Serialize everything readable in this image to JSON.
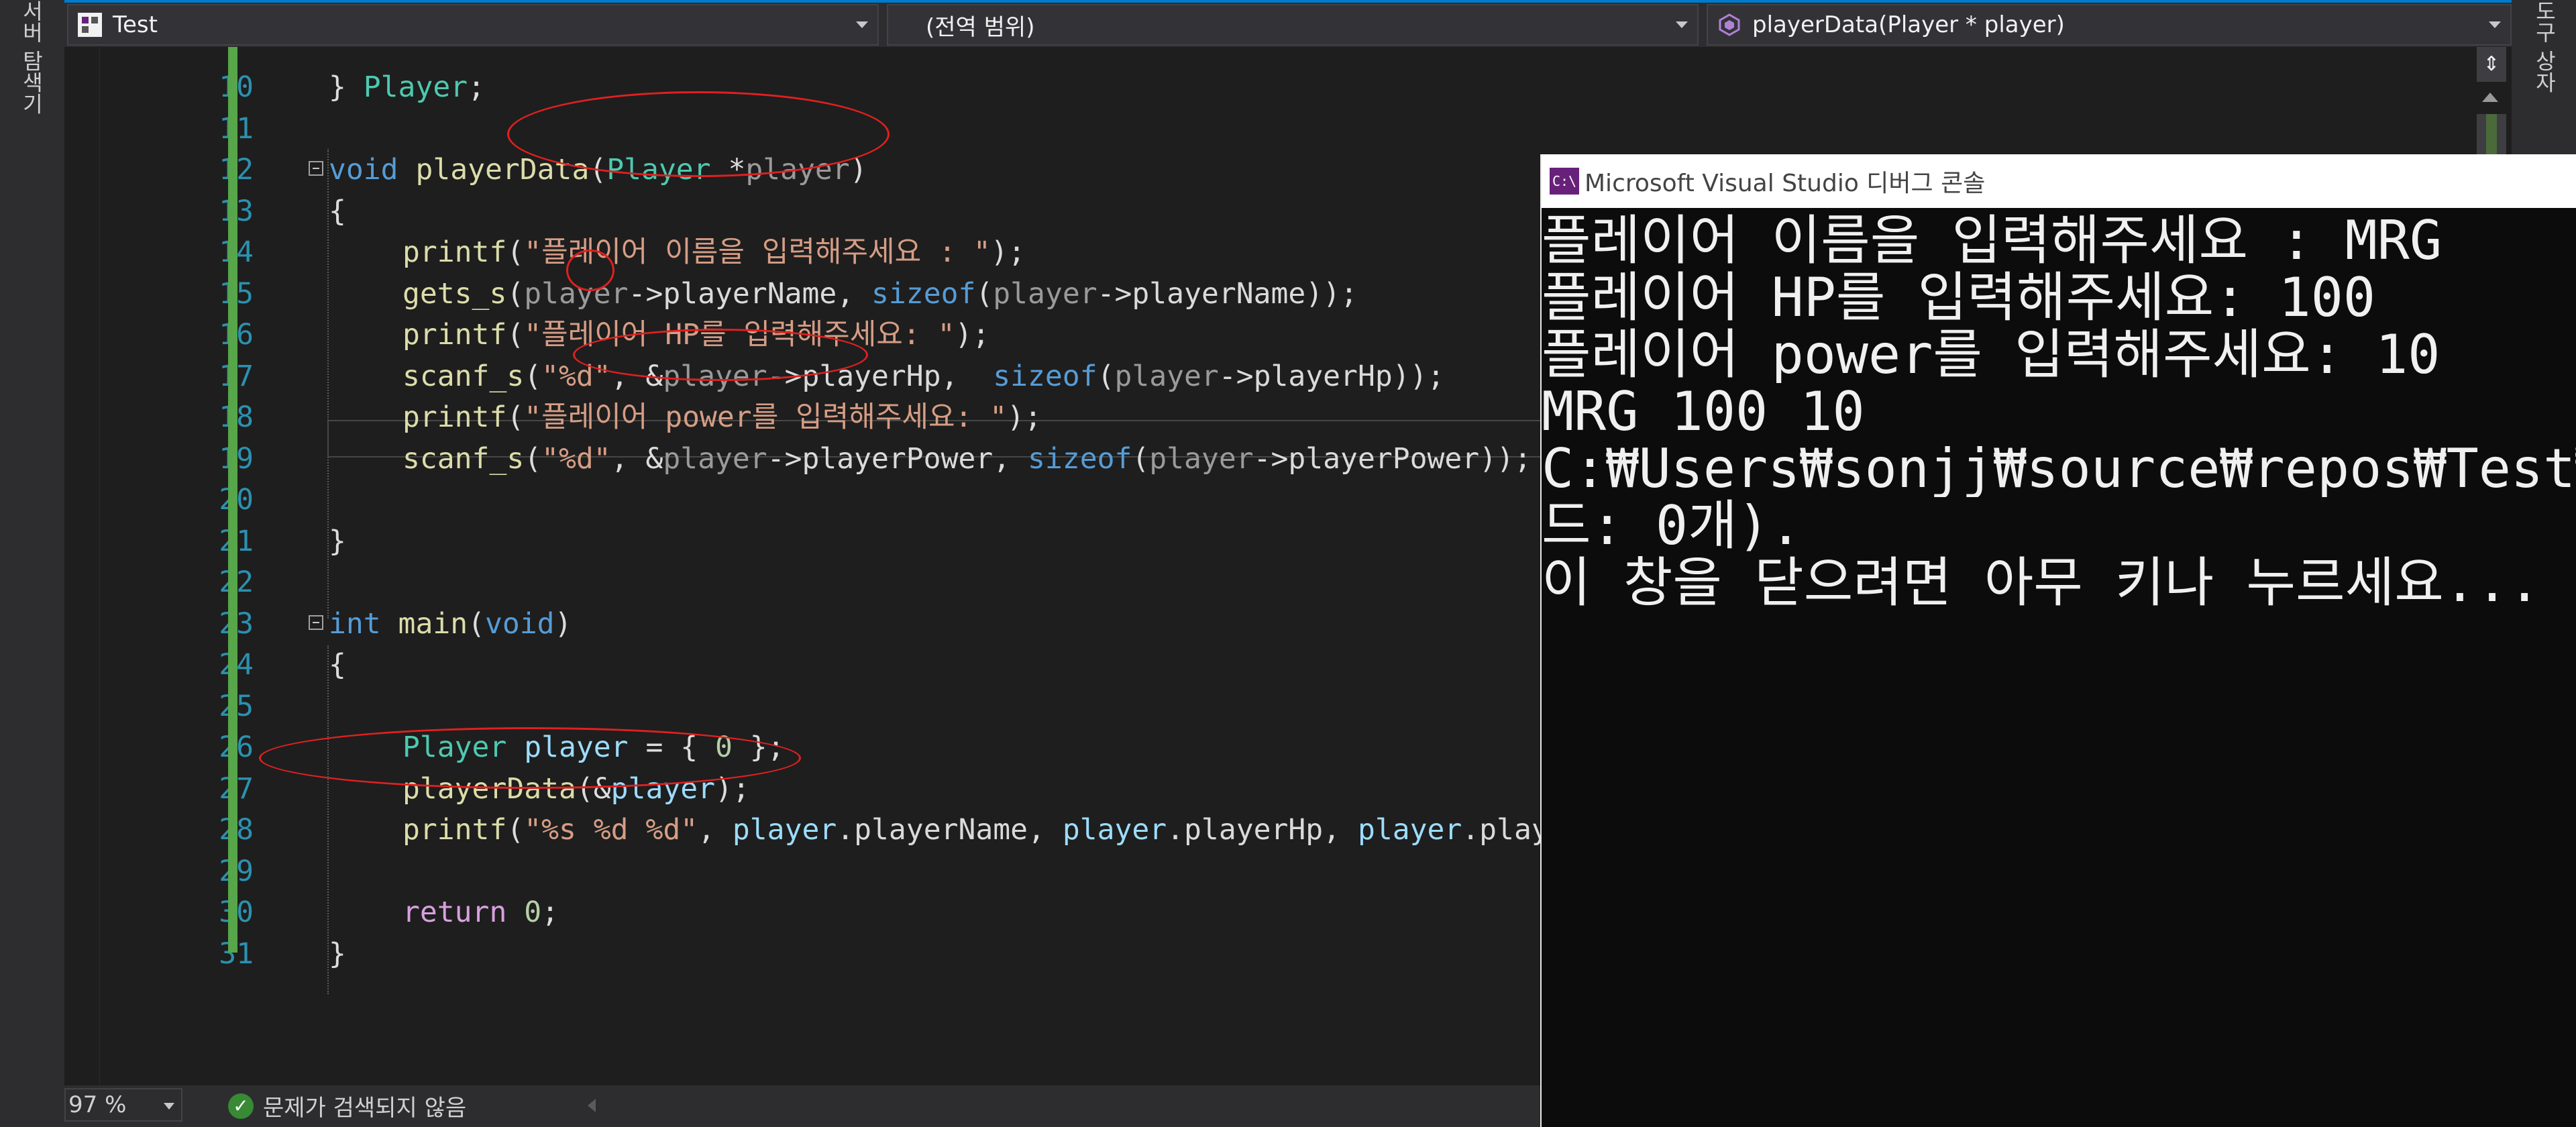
{
  "sidebars": {
    "left_label": "서버 탐색기",
    "right_label": "도구 상자"
  },
  "navbar": {
    "project": "Test",
    "scope": "(전역 범위)",
    "member": "playerData(Player * player)"
  },
  "editor": {
    "line_numbers": [
      "10",
      "11",
      "12",
      "13",
      "14",
      "15",
      "16",
      "17",
      "18",
      "19",
      "20",
      "21",
      "22",
      "23",
      "24",
      "25",
      "26",
      "27",
      "28",
      "29",
      "30",
      "31"
    ],
    "code": {
      "l10_close": "} ",
      "l10_type": "Player",
      "l10_semi": ";",
      "l12_void": "void",
      "l12_fn": "playerData",
      "l12_open": "(",
      "l12_type": "Player",
      "l12_star": " *",
      "l12_param": "player",
      "l12_close": ")",
      "l13": "{",
      "l14_fn": "printf",
      "l14_open": "(",
      "l14_str": "\"플레이어 이름을 입력해주세요 : \"",
      "l14_close": ");",
      "l15_fn": "gets_s",
      "l15_open": "(",
      "l15_p1": "player",
      "l15_arrow": "->",
      "l15_m1": "playerName",
      "l15_comma": ", ",
      "l15_sizeof": "sizeof",
      "l15_open2": "(",
      "l15_p2": "player",
      "l15_arrow2": "->",
      "l15_m2": "playerName",
      "l15_close": "));",
      "l16_fn": "printf",
      "l16_open": "(",
      "l16_str": "\"플레이어 HP를 입력해주세요: \"",
      "l16_close": ");",
      "l17_fn": "scanf_s",
      "l17_open": "(",
      "l17_str": "\"%d\"",
      "l17_comma": ", &",
      "l17_p1": "player",
      "l17_arrow": "->",
      "l17_m1": "playerHp",
      "l17_comma2": ",  ",
      "l17_sizeof": "sizeof",
      "l17_open2": "(",
      "l17_p2": "player",
      "l17_arrow2": "->",
      "l17_m2": "playerHp",
      "l17_close": "));",
      "l18_fn": "printf",
      "l18_open": "(",
      "l18_str": "\"플레이어 power를 입력해주세요: \"",
      "l18_close": ");",
      "l19_fn": "scanf_s",
      "l19_open": "(",
      "l19_str": "\"%d\"",
      "l19_comma": ", &",
      "l19_p1": "player",
      "l19_arrow": "->",
      "l19_m1": "playerPower",
      "l19_comma2": ", ",
      "l19_sizeof": "sizeof",
      "l19_open2": "(",
      "l19_p2": "player",
      "l19_arrow2": "->",
      "l19_m2": "playerPower",
      "l19_close": "));",
      "l21": "}",
      "l23_int": "int",
      "l23_fn": " main",
      "l23_open": "(",
      "l23_void": "void",
      "l23_close": ")",
      "l24": "{",
      "l26_type": "Player",
      "l26_var": " player",
      "l26_eq": " = { ",
      "l26_num": "0",
      "l26_close": " };",
      "l27_fn": "playerData",
      "l27_open": "(&",
      "l27_arg": "player",
      "l27_close": ");",
      "l28_fn": "printf",
      "l28_open": "(",
      "l28_str": "\"%s %d %d\"",
      "l28_c1": ", ",
      "l28_v1": "player",
      "l28_m1": ".playerName",
      "l28_c2": ", ",
      "l28_v2": "player",
      "l28_m2": ".playerHp",
      "l28_c3": ", ",
      "l28_v3": "player",
      "l28_m3": ".play",
      "l30_ret": "return",
      "l30_num": " 0",
      "l30_semi": ";",
      "l31": "}"
    }
  },
  "statusbar": {
    "zoom": "97 %",
    "issues": "문제가 검색되지 않음"
  },
  "console": {
    "title": "Microsoft Visual Studio 디버그 콘솔",
    "icon_text": "C:\\",
    "lines": [
      "플레이어 이름을 입력해주세요 : MRG",
      "플레이어 HP를 입력해주세요: 100",
      "플레이어 power를 입력해주세요: 10",
      "MRG 100 10",
      "C:₩Users₩sonjj₩source₩repos₩Test₩Debu",
      "드: 0개).",
      "이 창을 닫으려면 아무 키나 누르세요..."
    ]
  },
  "colors": {
    "accent": "#007acc",
    "change_bar": "#57a64a",
    "annotation": "#e02020",
    "keyword": "#569cd6",
    "type": "#4ec9b0",
    "function": "#dcdcaa",
    "string": "#d69d85"
  },
  "icons": {
    "project": "project-icon",
    "member": "method-icon",
    "issues": "check-circle-icon",
    "console": "console-app-icon"
  }
}
